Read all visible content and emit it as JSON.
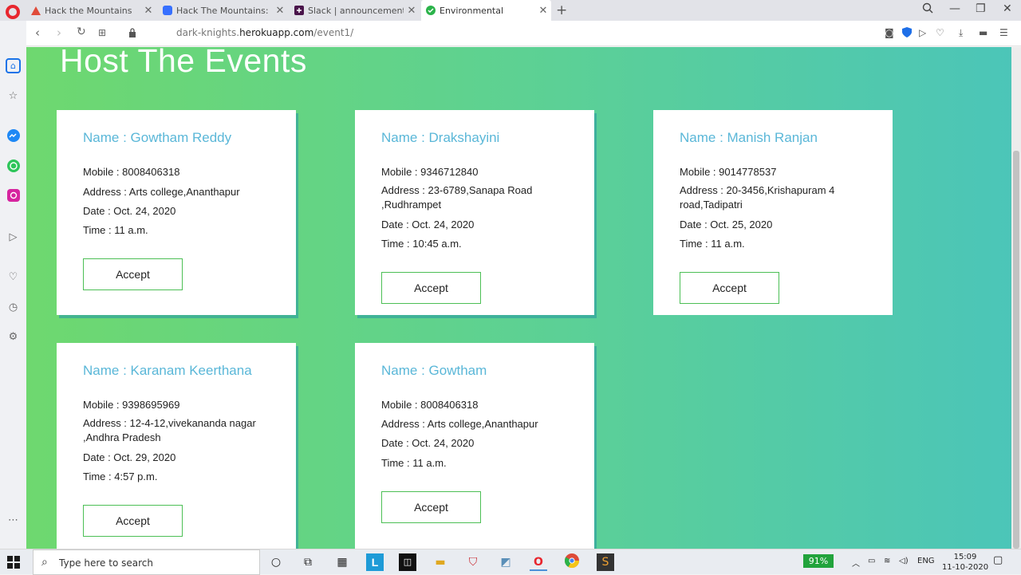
{
  "browser": {
    "tabs": [
      {
        "label": "Hack the Mountains",
        "active": false
      },
      {
        "label": "Hack The Mountains: Dash",
        "active": false
      },
      {
        "label": "Slack | announcements | H",
        "active": false
      },
      {
        "label": "Environmental",
        "active": true
      }
    ],
    "url_prefix": "dark-knights.",
    "url_host": "herokuapp.com",
    "url_path": "/event1/"
  },
  "page": {
    "title": "Host The Events",
    "accent_color": "#5ab7d8",
    "button_border_color": "#4cbf55",
    "events": [
      {
        "name": "Name  : Gowtham Reddy",
        "mobile": "Mobile : 8008406318",
        "address": "Address : Arts college,Ananthapur",
        "date": "Date : Oct. 24, 2020",
        "time": "Time : 11 a.m.",
        "button": "Accept"
      },
      {
        "name": "Name  :  Drakshayini",
        "mobile": "Mobile : 9346712840",
        "address": "Address :  23-6789,Sanapa Road ,Rudhrampet",
        "date": "Date : Oct. 24, 2020",
        "time": "Time : 10:45 a.m.",
        "button": "Accept"
      },
      {
        "name": "Name  : Manish Ranjan",
        "mobile": "Mobile : 9014778537",
        "address": "Address : 20-3456,Krishapuram 4 road,Tadipatri",
        "date": "Date : Oct. 25, 2020",
        "time": "Time : 11 a.m.",
        "button": "Accept"
      },
      {
        "name": "Name  : Karanam Keerthana",
        "mobile": "Mobile : 9398695969",
        "address": "Address : 12-4-12,vivekananda nagar ,Andhra Pradesh",
        "date": "Date : Oct. 29, 2020",
        "time": "Time : 4:57 p.m.",
        "button": "Accept"
      },
      {
        "name": "Name  : Gowtham",
        "mobile": "Mobile : 8008406318",
        "address": "Address : Arts college,Ananthapur",
        "date": "Date : Oct. 24, 2020",
        "time": "Time : 11 a.m.",
        "button": "Accept"
      }
    ]
  },
  "taskbar": {
    "search_placeholder": "Type here to search",
    "battery": "91%",
    "language": "ENG",
    "time": "15:09",
    "date": "11-10-2020"
  }
}
